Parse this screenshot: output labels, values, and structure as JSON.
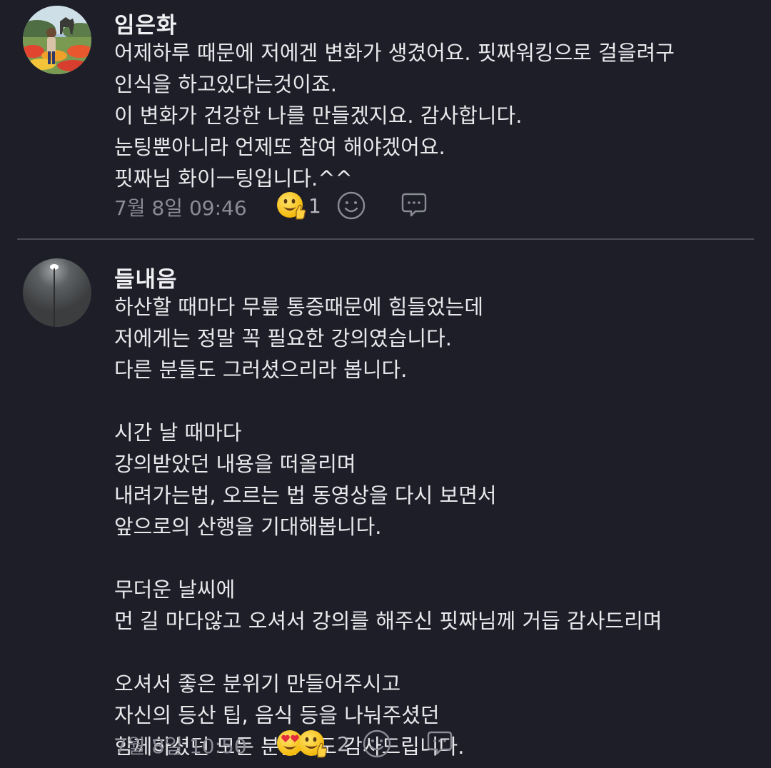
{
  "comments": [
    {
      "author": "임은화",
      "text": "어제하루 때문에 저에겐 변화가 생겼어요. 핏짜워킹으로 걸을려구\n인식을 하고있다는것이죠.\n이 변화가 건강한 나를 만들겠지요. 감사합니다.\n눈팅뿐아니라 언제또 참여 해야겠어요.\n핏짜님 화이ㅡ팅입니다.^^",
      "timestamp": "7월 8일 09:46",
      "reaction_count": "1",
      "reactions": [
        "thumbs-up-smile-emoji"
      ]
    },
    {
      "author": "들내음",
      "text": "하산할 때마다 무릎 통증때문에 힘들었는데\n저에게는 정말 꼭 필요한 강의였습니다.\n다른 분들도 그러셨으리라 봅니다.\n\n시간 날 때마다\n강의받았던 내용을 떠올리며\n내려가는법, 오르는 법 동영상을 다시 보면서\n앞으로의 산행을 기대해봅니다.\n\n무더운 날씨에\n먼 길 마다않고 오셔서 강의를 해주신 핏짜님께 거듭 감사드리며\n\n오셔서 좋은 분위기 만들어주시고\n자신의 등산 팁, 음식 등을 나눠주셨던\n함께하셨던 모든 분들께도 감사드립니다.",
      "timestamp": "7월 8일 10:50",
      "reaction_count": "2",
      "reactions": [
        "heart-eyes-emoji",
        "thumbs-up-smile-emoji"
      ]
    }
  ],
  "icons": {
    "add_reaction": "smiley-outline-icon",
    "reply": "speech-bubble-icon"
  },
  "colors": {
    "background": "#1d1e27",
    "text": "#e9e9ec",
    "meta": "#8a8b95",
    "divider": "#4a4b56",
    "emoji_yellow": "#f7c520"
  }
}
